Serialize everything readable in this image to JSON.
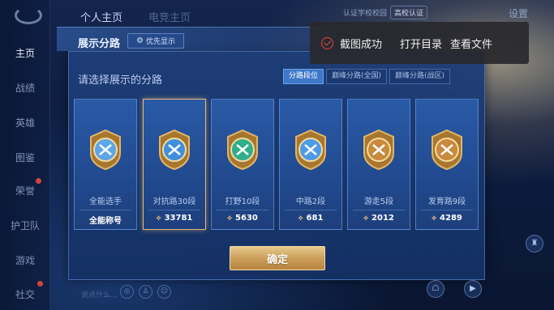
{
  "topbar": {
    "tabs": [
      "个人主页",
      "电竞主页"
    ],
    "verify_text": "认证学校校园",
    "school_badge": "高校认证",
    "settings_label": "设置"
  },
  "sidebar": {
    "items": [
      "主页",
      "战绩",
      "英雄",
      "图鉴",
      "荣誉",
      "护卫队",
      "游戏",
      "社交"
    ]
  },
  "dialog": {
    "header_title": "展示分路",
    "priority_label": "优先显示",
    "subtitle": "请选择展示的分路",
    "tabs": [
      "分路段位",
      "巅峰分路(全国)",
      "巅峰分路(战区)"
    ],
    "active_tab": 0,
    "cards": [
      {
        "name": "全能选手",
        "score": "全能称号",
        "badge": "allround-badge-icon",
        "selected": false,
        "show_icon": false
      },
      {
        "name": "对抗路30段",
        "score": "33781",
        "badge": "clash-lane-badge-icon",
        "selected": true,
        "show_icon": true
      },
      {
        "name": "打野10段",
        "score": "5630",
        "badge": "jungle-badge-icon",
        "selected": false,
        "show_icon": true
      },
      {
        "name": "中路2段",
        "score": "681",
        "badge": "mid-lane-badge-icon",
        "selected": false,
        "show_icon": true
      },
      {
        "name": "游走5段",
        "score": "2012",
        "badge": "roam-badge-icon",
        "selected": false,
        "show_icon": true
      },
      {
        "name": "发育路9段",
        "score": "4289",
        "badge": "farm-lane-badge-icon",
        "selected": false,
        "show_icon": true
      }
    ],
    "confirm_label": "确定"
  },
  "toast": {
    "message": "截图成功",
    "open_dir": "打开目录",
    "view_file": "查看文件"
  },
  "bottom": {
    "hint": "说点什么..."
  },
  "colors": {
    "accent_gold": "#e6b878",
    "active_tab": "#3f78c9",
    "toast_red": "#e3473d"
  }
}
